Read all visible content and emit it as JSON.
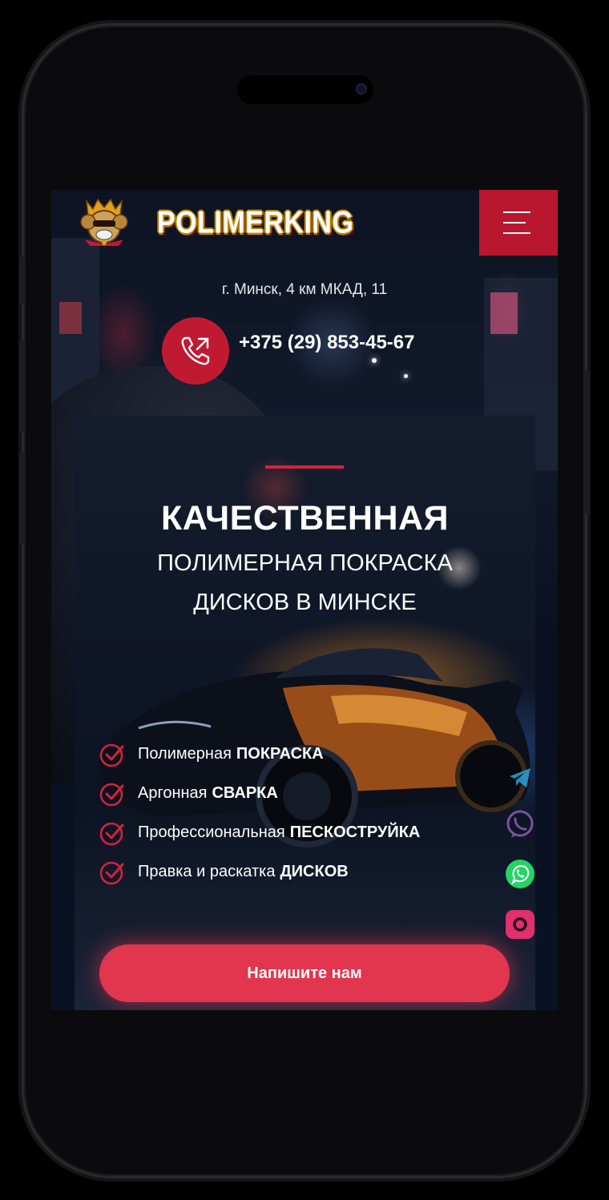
{
  "header": {
    "logo_text": "POLIMERKING",
    "menu_label": "menu"
  },
  "contact": {
    "address": "г. Минск, 4 км МКАД, 11",
    "phone": "+375 (29) 853-45-67"
  },
  "hero": {
    "title": "КАЧЕСТВЕННАЯ",
    "subtitle_line1": "ПОЛИМЕРНАЯ ПОКРАСКА",
    "subtitle_line2": "ДИСКОВ В МИНСКЕ",
    "features": [
      {
        "text": "Полимерная",
        "bold": "ПОКРАСКА"
      },
      {
        "text": "Аргонная",
        "bold": "СВАРКА"
      },
      {
        "text": "Профессиональная",
        "bold": "ПЕСКОСТРУЙКА"
      },
      {
        "text": "Правка и раскатка",
        "bold": "ДИСКОВ"
      }
    ],
    "cta_label": "Напишите нам"
  },
  "social": [
    "telegram-icon",
    "viber-icon",
    "whatsapp-icon",
    "instagram-icon"
  ],
  "colors": {
    "accent": "#b8172f",
    "button": "#e2354e",
    "whatsapp": "#25d366",
    "instagram": "#e1306c",
    "telegram": "#2aa3dc",
    "viber": "#7b519d"
  }
}
